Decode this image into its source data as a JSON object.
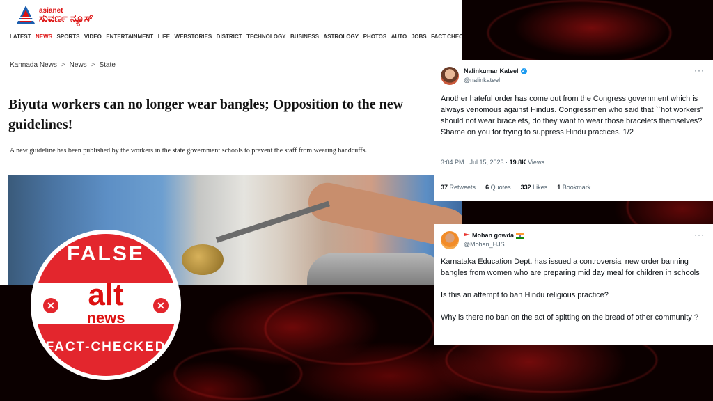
{
  "site": {
    "logo_line1": "asianet",
    "logo_line2": "ಸುವರ್ಣ ನ್ಯೂಸ್",
    "nav": [
      "LATEST",
      "NEWS",
      "SPORTS",
      "VIDEO",
      "ENTERTAINMENT",
      "LIFE",
      "WEBSTORIES",
      "DISTRICT",
      "TECHNOLOGY",
      "BUSINESS",
      "ASTROLOGY",
      "PHOTOS",
      "AUTO",
      "JOBS",
      "FACT CHECK"
    ],
    "nav_active": "NEWS"
  },
  "breadcrumb": [
    "Kannada News",
    "News",
    "State"
  ],
  "breadcrumb_sep": ">",
  "article": {
    "headline": "Biyuta workers can no longer wear bangles; Opposition to the new guidelines!",
    "summary": "A new guideline has been published by the workers in the state government schools to prevent the staff from wearing handcuffs."
  },
  "tweet1": {
    "name": "Nalinkumar Kateel",
    "handle": "@nalinkateel",
    "text": "Another hateful order has come out from the Congress government which is always venomous against Hindus. Congressmen who said that ``hot workers\" should not wear bracelets, do they want to wear those bracelets themselves? Shame on you for trying to suppress Hindu practices. 1/2",
    "time": "3:04 PM · Jul 15, 2023 · ",
    "views_count": "19.8K",
    "views_label": " Views",
    "stats": [
      {
        "count": "37",
        "label": "Retweets"
      },
      {
        "count": "6",
        "label": "Quotes"
      },
      {
        "count": "332",
        "label": "Likes"
      },
      {
        "count": "1",
        "label": "Bookmark"
      }
    ]
  },
  "tweet2": {
    "name": "Mohan gowda",
    "handle": "@Mohan_HJS",
    "text": "Karnataka Education Dept. has issued a controversial new order banning bangles from women who are preparing mid day meal for children in schools\n\nIs this an attempt to ban Hindu religious practice?\n\nWhy is there no ban on the act of spitting on the bread of other community ?"
  },
  "badge": {
    "top": "FALSE",
    "brand": "alt",
    "brand_sub": "news",
    "bottom": "FACT-CHECKED",
    "color": "#e3262d"
  },
  "more_icon": "more-horizontal-icon"
}
